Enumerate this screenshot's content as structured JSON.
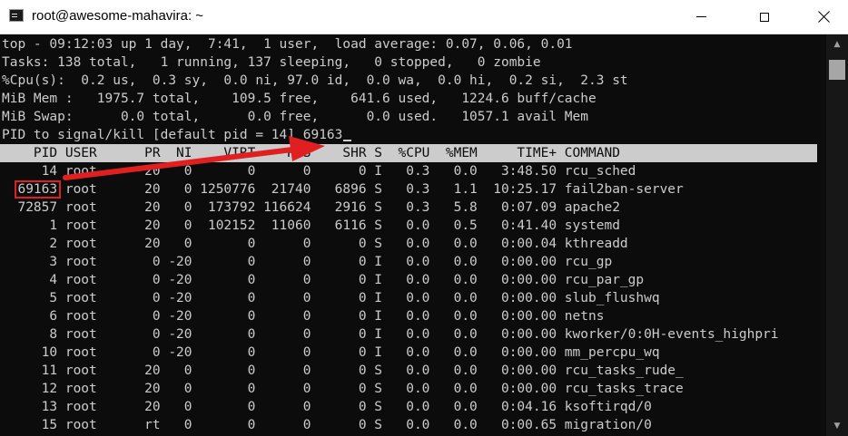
{
  "window": {
    "title": "root@awesome-mahavira: ~",
    "icon": "terminal-icon",
    "controls": [
      "minimize-icon",
      "maximize-icon",
      "close-icon"
    ]
  },
  "summary": [
    "top - 09:12:03 up 1 day,  7:41,  1 user,  load average: 0.07, 0.06, 0.01",
    "Tasks: 138 total,   1 running, 137 sleeping,   0 stopped,   0 zombie",
    "%Cpu(s):  0.2 us,  0.3 sy,  0.0 ni, 97.0 id,  0.0 wa,  0.0 hi,  0.2 si,  2.3 st",
    "MiB Mem :   1975.7 total,    109.5 free,    641.6 used,   1224.6 buff/cache",
    "MiB Swap:      0.0 total,      0.0 free,      0.0 used.   1057.1 avail Mem"
  ],
  "prompt": {
    "text": "PID to signal/kill [default pid = 14] ",
    "input_value": "69163"
  },
  "table_header": "    PID USER      PR  NI    VIRT    RES    SHR S  %CPU  %MEM     TIME+ COMMAND",
  "process_rows": [
    "     14 root      20   0       0      0      0 I   0.3   0.0   3:48.50 rcu_sched",
    "  69163 root      20   0 1250776  21740   6896 S   0.3   1.1  10:25.17 fail2ban-server",
    "  72857 root      20   0  173792 116624   2916 S   0.3   5.8   0:07.09 apache2",
    "      1 root      20   0  102152  11060   6116 S   0.0   0.5   0:41.40 systemd",
    "      2 root      20   0       0      0      0 S   0.0   0.0   0:00.04 kthreadd",
    "      3 root       0 -20       0      0      0 I   0.0   0.0   0:00.00 rcu_gp",
    "      4 root       0 -20       0      0      0 I   0.0   0.0   0:00.00 rcu_par_gp",
    "      5 root       0 -20       0      0      0 I   0.0   0.0   0:00.00 slub_flushwq",
    "      6 root       0 -20       0      0      0 I   0.0   0.0   0:00.00 netns",
    "      8 root       0 -20       0      0      0 I   0.0   0.0   0:00.00 kworker/0:0H-events_highpri",
    "     10 root       0 -20       0      0      0 I   0.0   0.0   0:00.00 mm_percpu_wq",
    "     11 root      20   0       0      0      0 S   0.0   0.0   0:00.00 rcu_tasks_rude_",
    "     12 root      20   0       0      0      0 S   0.0   0.0   0:00.00 rcu_tasks_trace",
    "     13 root      20   0       0      0      0 S   0.0   0.0   0:04.16 ksoftirqd/0",
    "     15 root      rt   0       0      0      0 S   0.0   0.0   0:00.65 migration/0"
  ],
  "annotation": {
    "color": "#e02020"
  },
  "colors": {
    "terminal_bg": "#0c0c0c",
    "terminal_fg": "#cccccc",
    "header_bg": "#cccccc"
  }
}
